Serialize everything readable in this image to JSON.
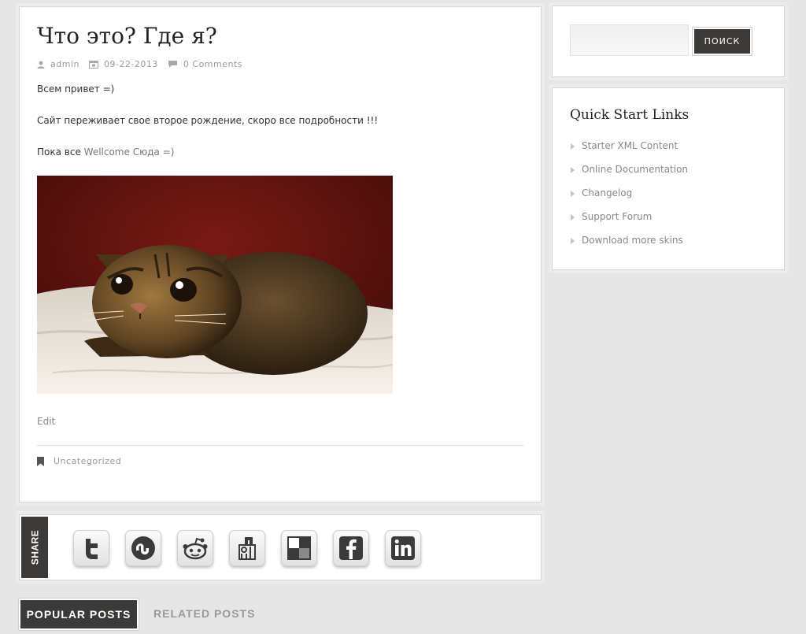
{
  "post": {
    "title": "Что это? Где я?",
    "author": "admin",
    "date": "09-22-2013",
    "comments": "0 Comments",
    "paragraph1": "Всем привет =)",
    "paragraph2": "Сайт переживает свое второе рождение, скоро все подробности !!!",
    "paragraph3_prefix": "Пока все ",
    "paragraph3_link": "Wellcome Сюда =)",
    "edit_label": "Edit",
    "category": "Uncategorized"
  },
  "share": {
    "label": "SHARE",
    "icons": [
      "twitter-icon",
      "stumbleupon-icon",
      "reddit-icon",
      "digg-icon",
      "delicious-icon",
      "facebook-icon",
      "linkedin-icon"
    ]
  },
  "tabs": {
    "popular": "POPULAR POSTS",
    "related": "RELATED POSTS"
  },
  "search": {
    "button_label": "ПОИСК",
    "placeholder": ""
  },
  "quick_links": {
    "title": "Quick Start Links",
    "items": [
      {
        "label": "Starter XML Content"
      },
      {
        "label": "Online Documentation"
      },
      {
        "label": "Changelog"
      },
      {
        "label": "Support Forum"
      },
      {
        "label": "Download more skins"
      }
    ]
  },
  "colors": {
    "background": "#e6e6e6",
    "panel": "#ffffff",
    "dark_button": "#3b3a38",
    "muted_text": "#999999",
    "link_text": "#888888"
  }
}
